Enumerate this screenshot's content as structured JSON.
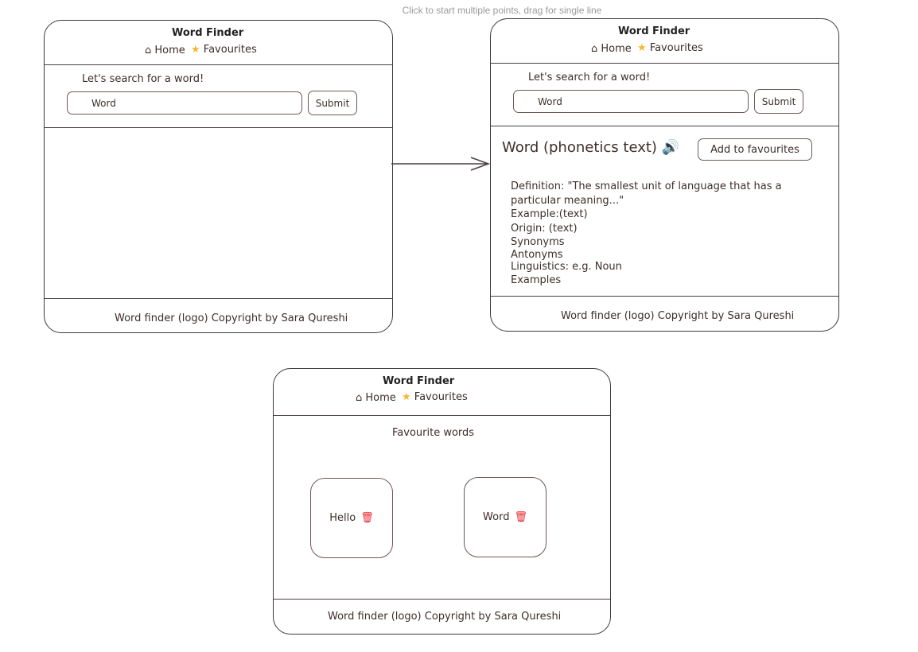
{
  "hint": "Click to start multiple points, drag for single line",
  "app_title": "Word Finder",
  "nav": {
    "home": "Home",
    "favourites": "Favourites"
  },
  "search": {
    "prompt": "Let's search for a word!",
    "value": "Word",
    "submit": "Submit"
  },
  "footer": "Word finder (logo) Copyright by Sara Qureshi",
  "result": {
    "heading": "Word (phonetics text)",
    "add_fav": "Add to favourites",
    "lines": [
      "Definition: \"The smallest unit of language that has a",
      "particular meaning...\"",
      "Example:(text)",
      "Origin: (text)",
      "Synonyms",
      "Antonyms",
      "Linguistics: e.g. Noun",
      "Examples"
    ]
  },
  "favourites": {
    "title": "Favourite words",
    "words": [
      "Hello",
      "Word"
    ]
  },
  "colors": {
    "star": "#f5b82e",
    "trash": "#e8232b"
  }
}
